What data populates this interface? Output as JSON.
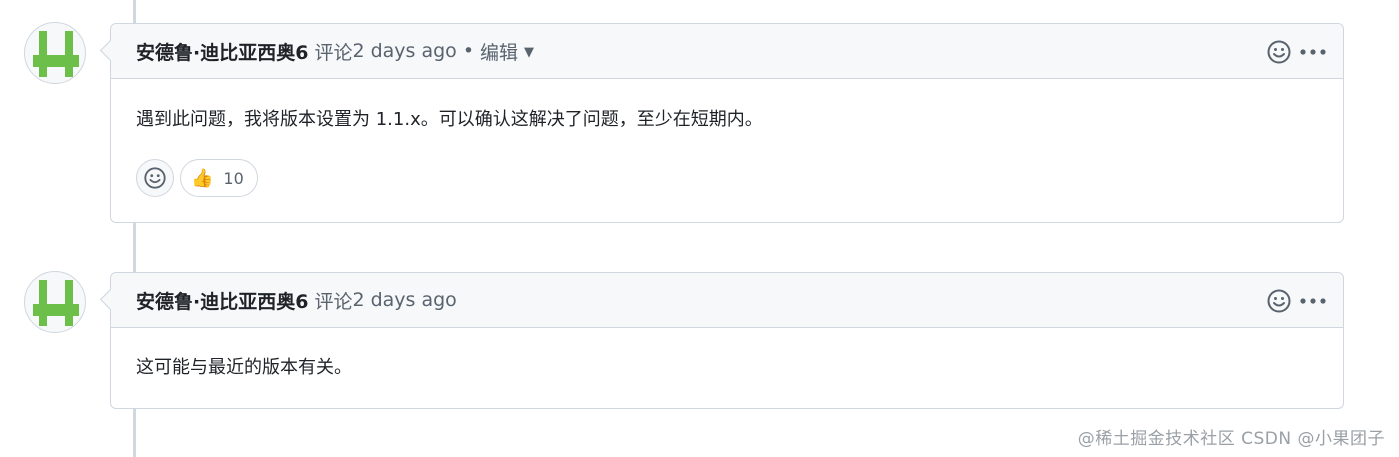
{
  "colors": {
    "avatar_green": "#6cc04a",
    "border": "#d0d7de",
    "header_bg": "#f6f8fa",
    "muted_text": "#59636e"
  },
  "comments": [
    {
      "author": "安德鲁·迪比亚西奥6",
      "action": "评论",
      "time": "2 days ago",
      "separator": "•",
      "edit_label": "编辑",
      "body": "遇到此问题，我将版本设置为 1.1.x。可以确认这解决了问题，至少在短期内。",
      "reaction": {
        "emoji": "👍",
        "count": "10"
      }
    },
    {
      "author": "安德鲁·迪比亚西奥6",
      "action": "评论",
      "time": "2 days ago",
      "body": "这可能与最近的版本有关。"
    }
  ],
  "icons": {
    "smiley": "smiley-icon",
    "more": "kebab-horizontal-icon",
    "edit_dropdown": "triangle-down-icon"
  },
  "watermark": "@稀土掘金技术社区 CSDN @小果团子"
}
